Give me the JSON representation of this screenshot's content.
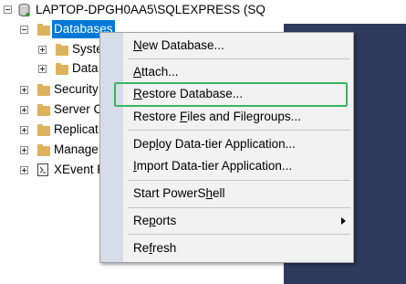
{
  "server_node": {
    "label": "LAPTOP-DPGH0AA5\\SQLEXPRESS (SQ"
  },
  "tree": {
    "databases": "Databases",
    "system": "System",
    "data": "Data",
    "security": "Security",
    "server": "Server C",
    "replication": "Replicat",
    "management": "Manage",
    "xevent": "XEvent P"
  },
  "menu": {
    "items": [
      {
        "pre": "",
        "key": "N",
        "post": "ew Database..."
      },
      {
        "pre": "",
        "key": "A",
        "post": "ttach..."
      },
      {
        "pre": "",
        "key": "R",
        "post": "estore Database..."
      },
      {
        "pre": "Restore ",
        "key": "F",
        "post": "iles and Filegroups..."
      },
      {
        "pre": "Dep",
        "key": "l",
        "post": "oy Data-tier Application..."
      },
      {
        "pre": "",
        "key": "I",
        "post": "mport Data-tier Application..."
      },
      {
        "pre": "Start PowerS",
        "key": "h",
        "post": "ell"
      },
      {
        "pre": "Re",
        "key": "p",
        "post": "orts"
      },
      {
        "pre": "Re",
        "key": "f",
        "post": "resh"
      }
    ]
  },
  "colors": {
    "selection": "#0078d7",
    "highlight_box": "#3cb55c",
    "background_panel": "#2e3a5c"
  }
}
